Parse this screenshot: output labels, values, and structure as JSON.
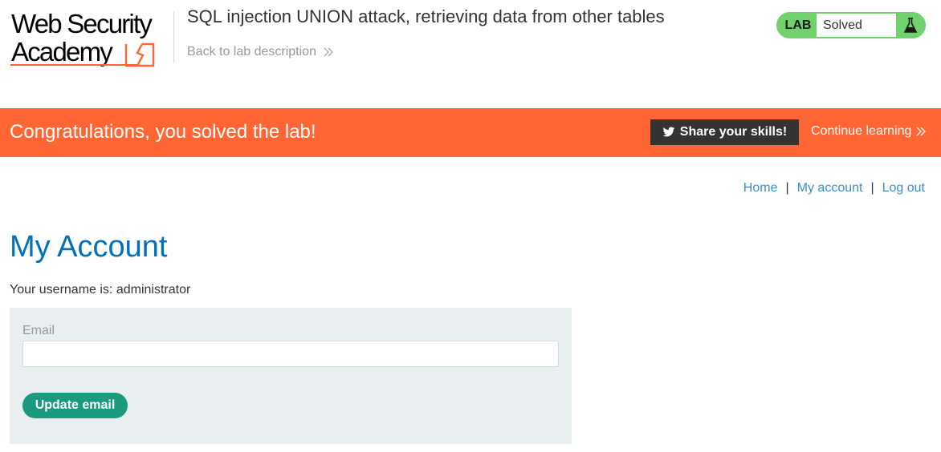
{
  "logo": {
    "line1": "Web Security",
    "line2": "Academy"
  },
  "header": {
    "lab_title": "SQL injection UNION attack, retrieving data from other tables",
    "back_link": "Back to lab description",
    "lab_status_label": "LAB",
    "lab_status_value": "Solved"
  },
  "banner": {
    "message": "Congratulations, you solved the lab!",
    "share_button": "Share your skills!",
    "continue_link": "Continue learning"
  },
  "nav": {
    "home": "Home",
    "my_account": "My account",
    "log_out": "Log out",
    "separator": "|"
  },
  "main": {
    "heading": "My Account",
    "username_line": "Your username is: administrator",
    "email_label": "Email",
    "email_value": "",
    "update_button": "Update email"
  },
  "colors": {
    "brand_orange": "#ff6633",
    "lab_green": "#70d16d",
    "link_blue": "#3a8fd0",
    "heading_blue": "#0071bc",
    "button_green": "#1a9a7e",
    "panel_bg": "#e9eef0"
  }
}
